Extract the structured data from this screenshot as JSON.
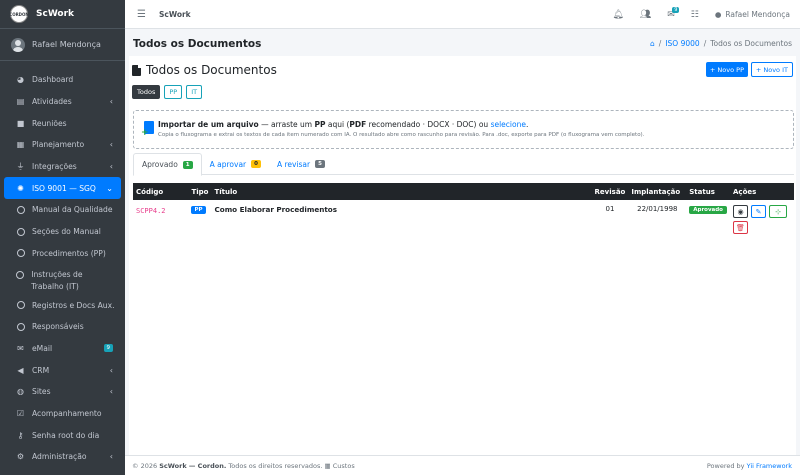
{
  "app": {
    "brand": "ScWork",
    "logo_text": "CORDON",
    "user": "Rafael Mendonça"
  },
  "sidebar": {
    "items": [
      {
        "label": "Dashboard",
        "icon": "palette-icon"
      },
      {
        "label": "Atividades",
        "icon": "clipboard-icon",
        "arrow": "‹"
      },
      {
        "label": "Reuniões",
        "icon": "video-icon"
      },
      {
        "label": "Planejamento",
        "icon": "calendar-icon",
        "arrow": "‹"
      },
      {
        "label": "Integrações",
        "icon": "plug-icon",
        "arrow": "‹"
      },
      {
        "label": "ISO 9001 — SGQ",
        "icon": "iso-icon",
        "arrow": "⌄"
      },
      {
        "label": "Manual da Qualidade"
      },
      {
        "label": "Seções do Manual"
      },
      {
        "label": "Procedimentos (PP)"
      },
      {
        "label": "Instruções de Trabalho (IT)"
      },
      {
        "label": "Registros e Docs Aux."
      },
      {
        "label": "Responsáveis"
      },
      {
        "label": "eMail",
        "icon": "envelope-icon",
        "badge": "9"
      },
      {
        "label": "CRM",
        "icon": "megaphone-icon",
        "arrow": "‹"
      },
      {
        "label": "Sites",
        "icon": "globe-icon",
        "arrow": "‹"
      },
      {
        "label": "Acompanhamento",
        "icon": "check-clipboard-icon"
      },
      {
        "label": "Senha root do dia",
        "icon": "key-icon"
      },
      {
        "label": "Administração",
        "icon": "gear-icon",
        "arrow": "‹"
      }
    ]
  },
  "topbar": {
    "title": "ScWork",
    "mail_badge": "9",
    "user": "Rafael Mendonça"
  },
  "page": {
    "title": "Todos os Documentos",
    "breadcrumb": {
      "home": "⌂",
      "sep": "/",
      "iso": "ISO 9000",
      "current": "Todos os Documentos"
    }
  },
  "card": {
    "title": "Todos os Documentos",
    "btn_new_pp": "+ Novo PP",
    "btn_new_it": "+ Novo IT",
    "filters": [
      "Todos",
      "PP",
      "IT"
    ],
    "import": {
      "strong": "Importar de um arquivo",
      "t1": " — arraste um ",
      "pp": "PP",
      "t2": " aqui (",
      "pdf": "PDF",
      "t3": " recomendado · DOCX · DOC) ou ",
      "link": "selecione",
      "t4": ".",
      "sub": "Copia o fluxograma e extrai os textos de cada item numerado com IA. O resultado abre como rascunho para revisão. Para .doc, exporte para PDF (o fluxograma vem completo)."
    },
    "tabs": [
      {
        "label": "Aprovado",
        "count": "1"
      },
      {
        "label": "A aprovar",
        "count": "0"
      },
      {
        "label": "A revisar",
        "count": "5"
      }
    ]
  },
  "table": {
    "headers": [
      "Código",
      "Tipo",
      "Título",
      "Revisão",
      "Implantação",
      "Status",
      "Ações"
    ],
    "rows": [
      {
        "code": "SCPP4.2",
        "type": "PP",
        "title": "Como Elaborar Procedimentos",
        "revision": "01",
        "date": "22/01/1998",
        "status": "Aprovado"
      }
    ]
  },
  "footer": {
    "copyright": "© 2026 ",
    "brand": "ScWork — Cordon.",
    "rights": " Todos os direitos reservados.",
    "costs": "Custos",
    "powered": "Powered by ",
    "framework": "Yii Framework"
  }
}
